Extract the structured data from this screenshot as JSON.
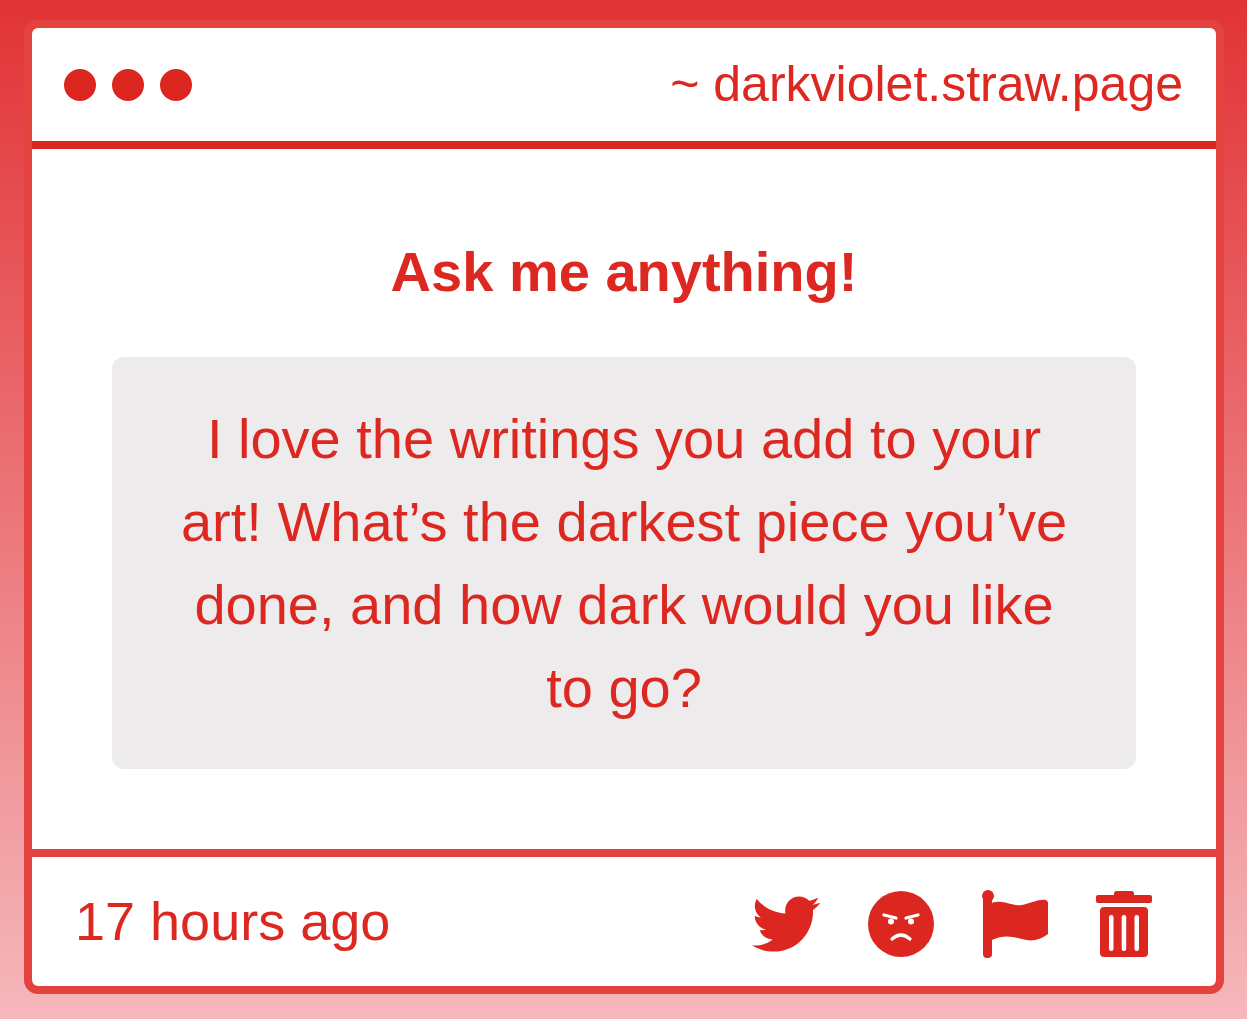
{
  "window": {
    "address": "~ darkviolet.straw.page"
  },
  "heading": "Ask me anything!",
  "question": "I love the writings you add to your art! What’s the darkest piece you’ve done, and how dark would you like to go?",
  "footer": {
    "time": "17 hours ago"
  }
}
